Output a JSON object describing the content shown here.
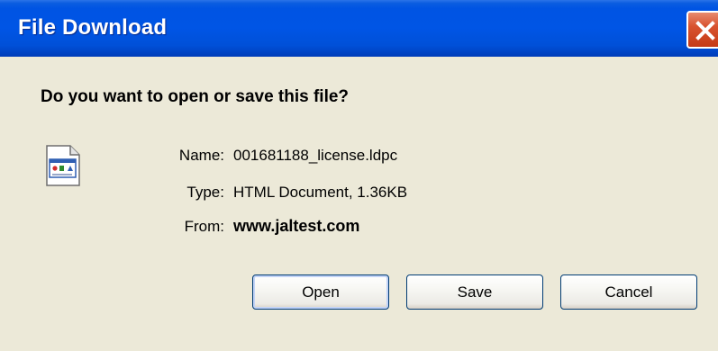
{
  "window": {
    "title": "File Download",
    "close_icon": "close-icon"
  },
  "dialog": {
    "question": "Do you want to open or save this file?",
    "file_icon": "html-document-icon",
    "name_label": "Name:",
    "name_value": "001681188_license.ldpc",
    "type_label": "Type:",
    "type_value": "HTML Document, 1.36KB",
    "from_label": "From:",
    "from_value": "www.jaltest.com"
  },
  "buttons": {
    "open_label": "Open",
    "save_label": "Save",
    "cancel_label": "Cancel"
  },
  "colors": {
    "titlebar": "#0055e5",
    "dialog_bg": "#ece9d8",
    "close_button": "#d8532f"
  }
}
